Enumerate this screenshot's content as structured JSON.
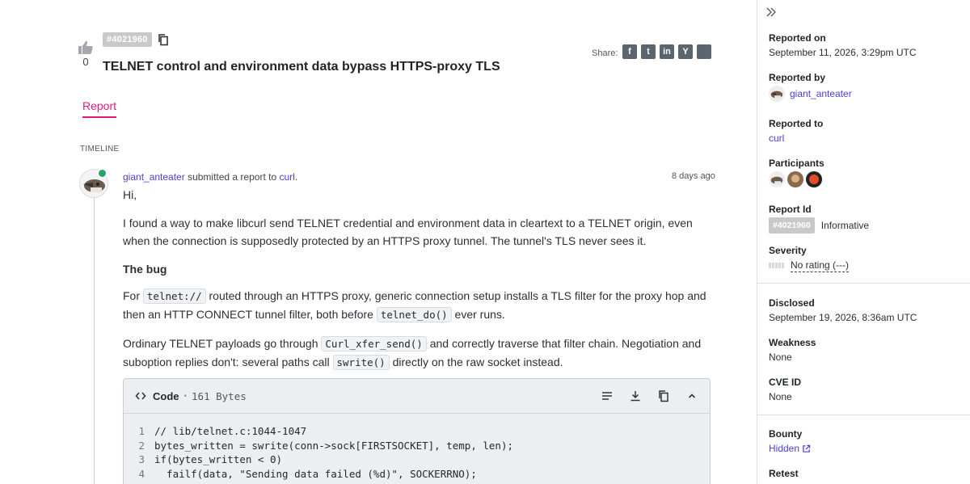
{
  "report": {
    "id_badge": "#4021960",
    "title": "TELNET control and environment data bypass HTTPS-proxy TLS",
    "vote_count": "0",
    "share_label": "Share:",
    "share_icons": [
      "facebook-icon",
      "twitter-icon",
      "linkedin-icon",
      "ycombinator-icon",
      "more-icon"
    ],
    "share_glyphs": [
      "f",
      "t",
      "in",
      "Y",
      ""
    ],
    "tab_label": "Report"
  },
  "timeline": {
    "label": "TIMELINE",
    "event": {
      "user": "giant_anteater",
      "action": " submitted a report to ",
      "target": "curl",
      "period": ".",
      "time": "8 days ago"
    },
    "body": {
      "greeting": "Hi,",
      "p1": "I found a way to make libcurl send TELNET credential and environment data in cleartext to a TELNET origin, even when the connection is supposedly protected by an HTTPS proxy tunnel. The tunnel's TLS never sees it.",
      "heading": "The bug",
      "p2_a": "For ",
      "p2_code1": "telnet://",
      "p2_b": " routed through an HTTPS proxy, generic connection setup installs a TLS filter for the proxy hop and then an HTTP CONNECT tunnel filter, both before ",
      "p2_code2": "telnet_do()",
      "p2_c": " ever runs.",
      "p3_a": "Ordinary TELNET payloads go through ",
      "p3_code1": "Curl_xfer_send()",
      "p3_b": " and correctly traverse that filter chain. Negotiation and suboption replies don't: several paths call ",
      "p3_code2": "swrite()",
      "p3_c": " directly on the raw socket instead."
    },
    "code": {
      "title": "Code",
      "size": "161 Bytes",
      "lines": [
        {
          "n": "1",
          "text": "// lib/telnet.c:1044-1047"
        },
        {
          "n": "2",
          "text": "bytes_written = swrite(conn->sock[FIRSTSOCKET], temp, len);"
        },
        {
          "n": "3",
          "text": "if(bytes_written < 0)"
        },
        {
          "n": "4",
          "text": "  failf(data, \"Sending data failed (%d)\", SOCKERRNO);"
        }
      ]
    }
  },
  "sidebar": {
    "reported_on_label": "Reported on",
    "reported_on": "September 11, 2026, 3:29pm UTC",
    "reported_by_label": "Reported by",
    "reported_by": "giant_anteater",
    "reported_to_label": "Reported to",
    "reported_to": "curl",
    "participants_label": "Participants",
    "report_id_label": "Report Id",
    "report_id": "#4021960",
    "report_state": "Informative",
    "severity_label": "Severity",
    "severity": "No rating (---)",
    "disclosed_label": "Disclosed",
    "disclosed": "September 19, 2026, 8:36am UTC",
    "weakness_label": "Weakness",
    "weakness": "None",
    "cve_label": "CVE ID",
    "cve": "None",
    "bounty_label": "Bounty",
    "bounty": "Hidden",
    "retest_label": "Retest"
  },
  "colors": {
    "accent": "#e0197d",
    "link": "#4a3fd6",
    "verified": "#2aa36a"
  }
}
